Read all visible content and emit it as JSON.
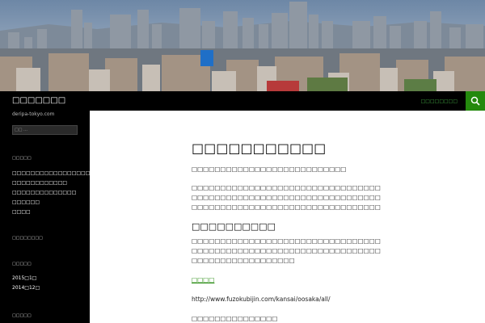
{
  "header": {
    "site_title": "□□□□□□□",
    "menu_label": "□□□□□□□□",
    "search_icon": "search-icon"
  },
  "sidebar": {
    "tagline": "deripa-tokyo.com",
    "search_placeholder": "□□ …",
    "widget_recent_title": "□□□□□",
    "recent_posts": [
      "□□□□□□□□□□□□□□□□□□□□",
      "□□□□□□□□□□□□",
      "□□□□□□□□□□□□□□",
      "□□□□□□",
      "□□□□"
    ],
    "widget_comments_title": "□□□□□□□□",
    "widget_archive_title": "□□□□□",
    "archives": [
      "2015□1□",
      "2014□12□"
    ],
    "widget_category_title": "□□□□□"
  },
  "post": {
    "title": "□□□□□□□□□□□",
    "p1": "□□□□□□□□□□□□□□□□□□□□□□□□□□□",
    "p2": "□□□□□□□□□□□□□□□□□□□□□□□□□□□□□□□□□□□□□□□□□□□□□□□□□□□□□□□□□□□□□□□□□□□□□□□□□□□□□□□□□□□□□□□□□□□□□□□□□□□",
    "h2": "□□□□□□□□□□",
    "p3": "□□□□□□□□□□□□□□□□□□□□□□□□□□□□□□□□□□□□□□□□□□□□□□□□□□□□□□□□□□□□□□□□□□□□□□□□□□□□□□□□□□□□",
    "link_text": "□□□□",
    "url": "http://www.fuzokubijin.com/kansai/oosaka/all/",
    "p4": "□□□□□□□□□□□□□□□"
  }
}
